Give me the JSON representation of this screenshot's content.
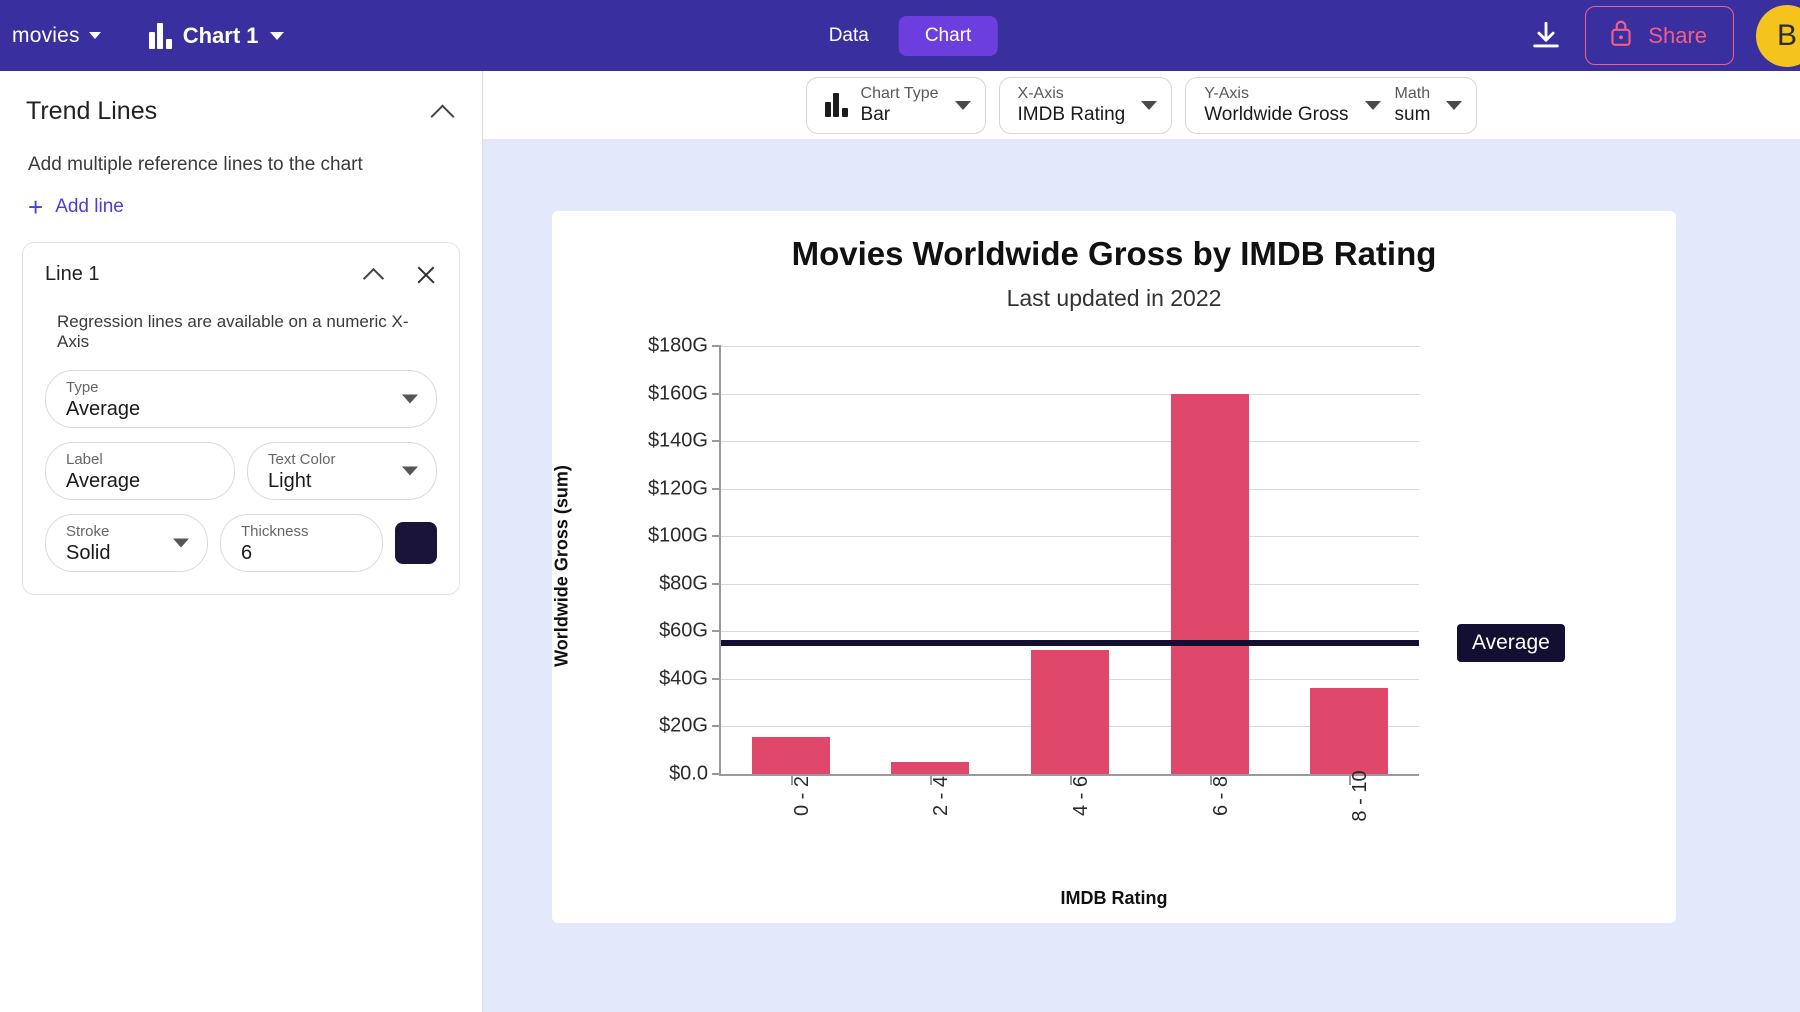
{
  "topbar": {
    "database_name": "movies",
    "chart_name": "Chart 1",
    "chart_icon": "bar-chart-icon",
    "tabs": [
      {
        "label": "Data",
        "active": false
      },
      {
        "label": "Chart",
        "active": true
      }
    ],
    "download_icon": "download-icon",
    "share_label": "Share",
    "share_lock_icon": "lock-icon",
    "avatar_initial": "B",
    "colors": {
      "bar_background": "#3a2f9e",
      "active_tab": "#6d3ede",
      "share_accent": "#ef5f8a",
      "avatar": "#f5c41c"
    }
  },
  "sidebar": {
    "title": "Trend Lines",
    "collapse_icon": "chevron-up-icon",
    "description": "Add multiple reference lines to the chart",
    "add_line_label": "Add line",
    "add_line_icon": "plus-icon",
    "line_card": {
      "title": "Line 1",
      "collapse_icon": "chevron-up-icon",
      "close_icon": "close-icon",
      "hint": "Regression lines are available on a numeric X-Axis",
      "fields": {
        "type": {
          "label": "Type",
          "value": "Average"
        },
        "label": {
          "label": "Label",
          "value": "Average"
        },
        "text_color": {
          "label": "Text Color",
          "value": "Light"
        },
        "stroke": {
          "label": "Stroke",
          "value": "Solid"
        },
        "thickness": {
          "label": "Thickness",
          "value": "6"
        }
      },
      "color_swatch": "#1a1438"
    }
  },
  "collapse_handle_icon": "chevron-left-icon",
  "toolbar": {
    "chart_type": {
      "label": "Chart Type",
      "value": "Bar",
      "icon": "bar-chart-icon"
    },
    "x_axis": {
      "label": "X-Axis",
      "value": "IMDB Rating"
    },
    "y_axis": {
      "label": "Y-Axis",
      "value": "Worldwide Gross"
    },
    "math": {
      "label": "Math",
      "value": "sum"
    }
  },
  "chart_data": {
    "type": "bar",
    "title": "Movies Worldwide Gross by IMDB Rating",
    "subtitle": "Last updated in 2022",
    "xlabel": "IMDB Rating",
    "ylabel": "Worldwide Gross (sum)",
    "categories": [
      "0 - 2",
      "2 - 4",
      "4 - 6",
      "6 - 8",
      "8 - 10"
    ],
    "values": [
      15.5,
      5.0,
      52.0,
      160.0,
      36.0
    ],
    "bar_color": "#e0486b",
    "ylim": [
      0,
      180
    ],
    "ytick_values": [
      0,
      20,
      40,
      60,
      80,
      100,
      120,
      140,
      160,
      180
    ],
    "ytick_labels": [
      "$0.0",
      "$20G",
      "$40G",
      "$60G",
      "$80G",
      "$100G",
      "$120G",
      "$140G",
      "$160G",
      "$180G"
    ],
    "grid": true,
    "legend": "none",
    "annotations": [
      {
        "kind": "trend-line",
        "label": "Average",
        "value": 55.0,
        "stroke": "Solid",
        "thickness": 6,
        "color": "#120f33",
        "text_color": "Light"
      }
    ]
  }
}
